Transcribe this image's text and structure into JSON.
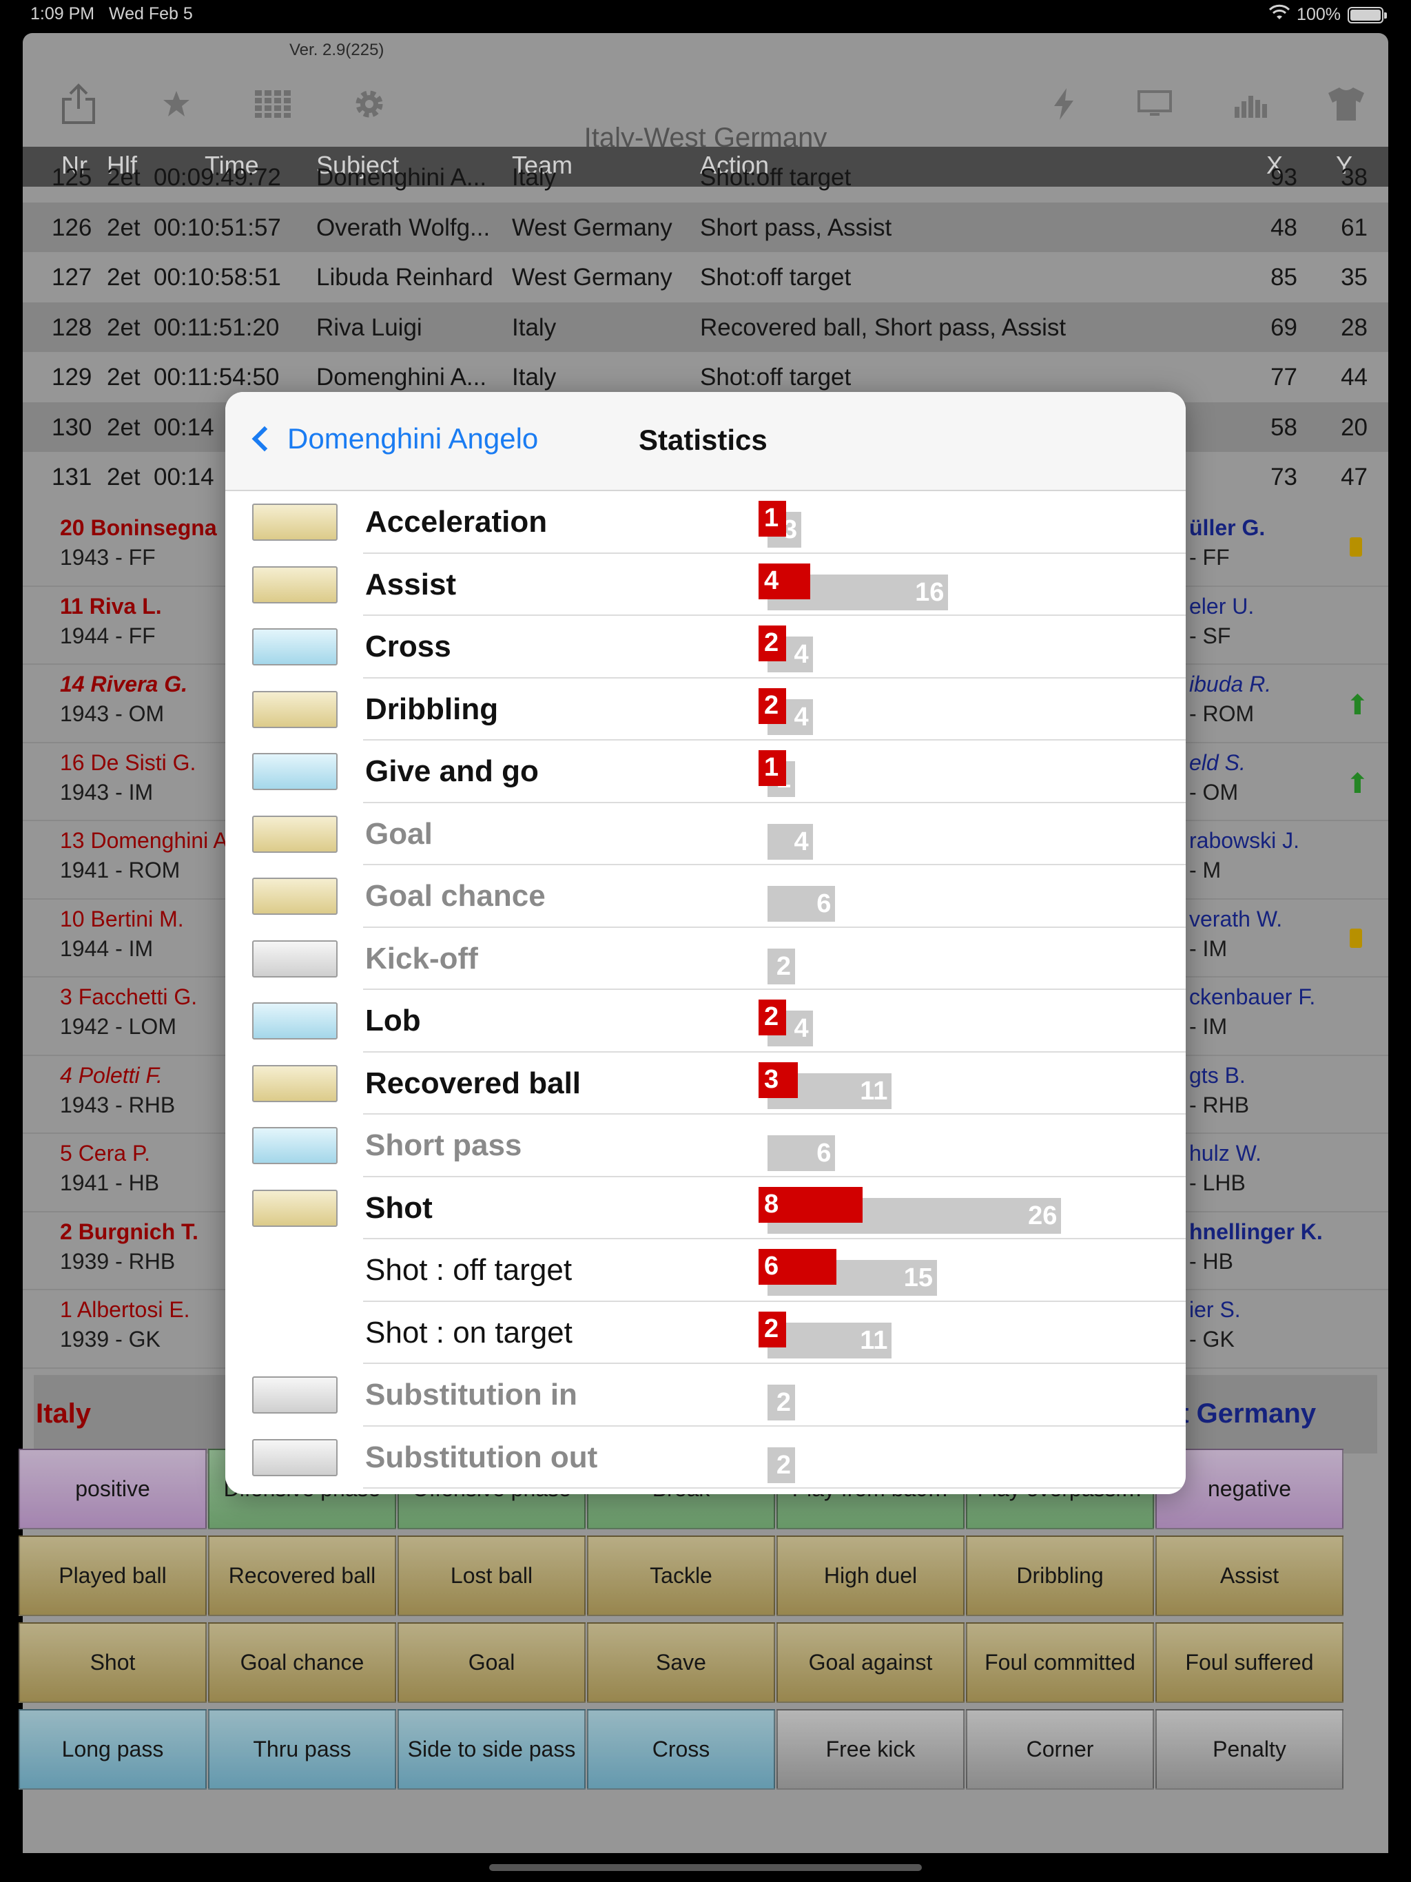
{
  "status": {
    "time": "1:09 PM",
    "date": "Wed Feb 5",
    "battery": "100%"
  },
  "app": {
    "version": "Ver. 2.9(225)",
    "title": "Italy-West Germany",
    "toolbar_icons": [
      "share-icon",
      "star-icon",
      "grid-icon",
      "gear-icon",
      "lightning-icon",
      "monitor-icon",
      "bar-chart-icon",
      "shirt-icon"
    ]
  },
  "table": {
    "headers": {
      "nr": "Nr",
      "hlf": "Hlf",
      "time": "Time",
      "subject": "Subject",
      "team": "Team",
      "action": "Action",
      "x": "X",
      "y": "Y"
    },
    "rows": [
      {
        "nr": "125",
        "hlf": "2et",
        "time": "00:09:49:72",
        "subject": "Domenghini A...",
        "team": "Italy",
        "action": "Shot:off target",
        "x": "93",
        "y": "38"
      },
      {
        "nr": "126",
        "hlf": "2et",
        "time": "00:10:51:57",
        "subject": "Overath Wolfg...",
        "team": "West Germany",
        "action": "Short pass, Assist",
        "x": "48",
        "y": "61"
      },
      {
        "nr": "127",
        "hlf": "2et",
        "time": "00:10:58:51",
        "subject": "Libuda Reinhard",
        "team": "West Germany",
        "action": "Shot:off target",
        "x": "85",
        "y": "35"
      },
      {
        "nr": "128",
        "hlf": "2et",
        "time": "00:11:51:20",
        "subject": "Riva Luigi",
        "team": "Italy",
        "action": "Recovered ball, Short pass, Assist",
        "x": "69",
        "y": "28"
      },
      {
        "nr": "129",
        "hlf": "2et",
        "time": "00:11:54:50",
        "subject": "Domenghini A...",
        "team": "Italy",
        "action": "Shot:off target",
        "x": "77",
        "y": "44"
      },
      {
        "nr": "130",
        "hlf": "2et",
        "time": "00:14",
        "subject": "",
        "team": "",
        "action": "",
        "x": "58",
        "y": "20"
      },
      {
        "nr": "131",
        "hlf": "2et",
        "time": "00:14",
        "subject": "",
        "team": "",
        "action": "",
        "x": "73",
        "y": "47"
      }
    ]
  },
  "players_left": [
    {
      "name": "20 Boninsegna",
      "info": "1943 - FF"
    },
    {
      "name": "11 Riva L.",
      "info": "1944 - FF"
    },
    {
      "name": "14 Rivera G.",
      "info": "1943 - OM"
    },
    {
      "name": "16 De Sisti G.",
      "info": "1943 - IM"
    },
    {
      "name": "13 Domenghini A",
      "info": "1941 - ROM"
    },
    {
      "name": "10 Bertini M.",
      "info": "1944 - IM"
    },
    {
      "name": "3 Facchetti G.",
      "info": "1942 - LOM"
    },
    {
      "name": "4 Poletti F.",
      "info": "1943 - RHB"
    },
    {
      "name": "5 Cera P.",
      "info": "1941 - HB"
    },
    {
      "name": "2 Burgnich T.",
      "info": "1939 - RHB"
    },
    {
      "name": "1 Albertosi E.",
      "info": "1939 - GK"
    }
  ],
  "players_right": [
    {
      "name": "üller G.",
      "info": "- FF"
    },
    {
      "name": "eler U.",
      "info": "- SF"
    },
    {
      "name": "ibuda R.",
      "info": "- ROM"
    },
    {
      "name": "eld S.",
      "info": "- OM"
    },
    {
      "name": "rabowski J.",
      "info": "- M"
    },
    {
      "name": "verath W.",
      "info": "- IM"
    },
    {
      "name": "ckenbauer F.",
      "info": "- IM"
    },
    {
      "name": "gts B.",
      "info": "- RHB"
    },
    {
      "name": "hulz W.",
      "info": "- LHB"
    },
    {
      "name": "hnellinger K.",
      "info": "- HB"
    },
    {
      "name": "ier S.",
      "info": "- GK"
    }
  ],
  "teams": {
    "left": "Italy",
    "right": "st Germany"
  },
  "buttons": [
    [
      "positive",
      "Difensive phase",
      "Offensive phase",
      "Break",
      "Play from bac…",
      "Play overpassi…",
      "negative"
    ],
    [
      "Played ball",
      "Recovered ball",
      "Lost ball",
      "Tackle",
      "High duel",
      "Dribbling",
      "Assist"
    ],
    [
      "Shot",
      "Goal chance",
      "Goal",
      "Save",
      "Goal against",
      "Foul committed",
      "Foul suffered"
    ],
    [
      "Long pass",
      "Thru pass",
      "Side to side pass",
      "Cross",
      "Free kick",
      "Corner",
      "Penalty"
    ]
  ],
  "popup": {
    "back_label": "Domenghini Angelo",
    "title": "Statistics"
  },
  "stats": [
    {
      "label": "Acceleration",
      "player": 1,
      "total": 3
    },
    {
      "label": "Assist",
      "player": 4,
      "total": 16
    },
    {
      "label": "Cross",
      "player": 2,
      "total": 4
    },
    {
      "label": "Dribbling",
      "player": 2,
      "total": 4
    },
    {
      "label": "Give and go",
      "player": 1,
      "total": 1
    },
    {
      "label": "Goal",
      "player": 0,
      "total": 4
    },
    {
      "label": "Goal chance",
      "player": 0,
      "total": 6
    },
    {
      "label": "Kick-off",
      "player": 0,
      "total": 2
    },
    {
      "label": "Lob",
      "player": 2,
      "total": 4
    },
    {
      "label": "Recovered ball",
      "player": 3,
      "total": 11
    },
    {
      "label": "Short pass",
      "player": 0,
      "total": 6
    },
    {
      "label": "Shot",
      "player": 8,
      "total": 26
    },
    {
      "label": "Shot : off target",
      "player": 6,
      "total": 15
    },
    {
      "label": "Shot : on target",
      "player": 2,
      "total": 11
    },
    {
      "label": "Substitution in",
      "player": 0,
      "total": 2
    },
    {
      "label": "Substitution out",
      "player": 0,
      "total": 2
    }
  ],
  "colors": {
    "player_bar": "#d10000",
    "total_bar": "#c9c9c9",
    "link_blue": "#1a7cf2",
    "italy_red": "#b00000",
    "germany_blue": "#1a2a9a"
  }
}
